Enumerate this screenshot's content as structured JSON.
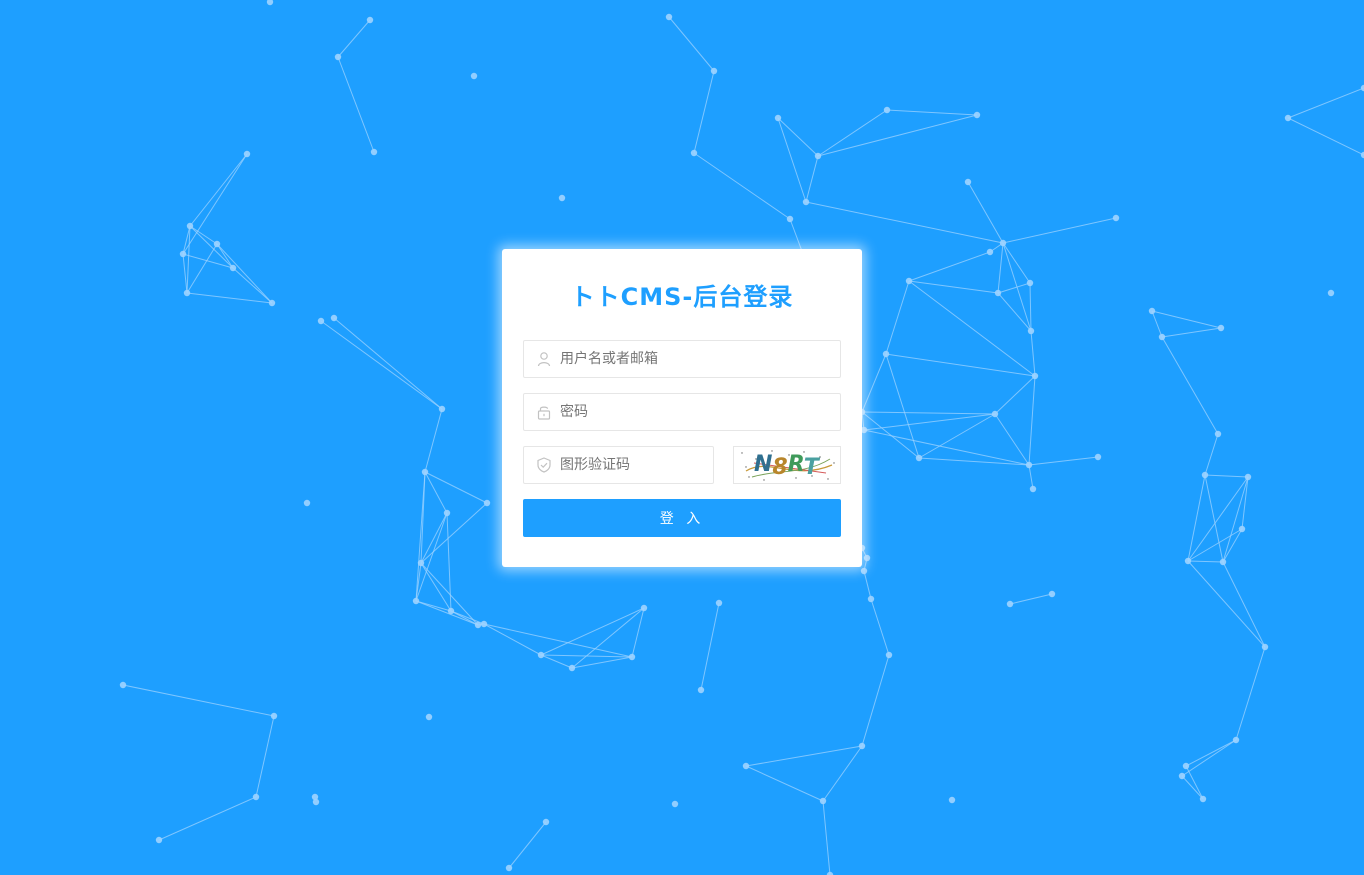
{
  "login": {
    "title": "トトCMS-后台登录",
    "username_placeholder": "用户名或者邮箱",
    "password_placeholder": "密码",
    "captcha_placeholder": "图形验证码",
    "captcha_text": "N8RT",
    "submit_label": "登 入"
  },
  "icons": {
    "username": "user-icon",
    "password": "lock-icon",
    "captcha": "shield-check-icon"
  },
  "colors": {
    "background": "#1e9fff",
    "accent": "#1e9fff",
    "particle": "#9fd3ff"
  }
}
